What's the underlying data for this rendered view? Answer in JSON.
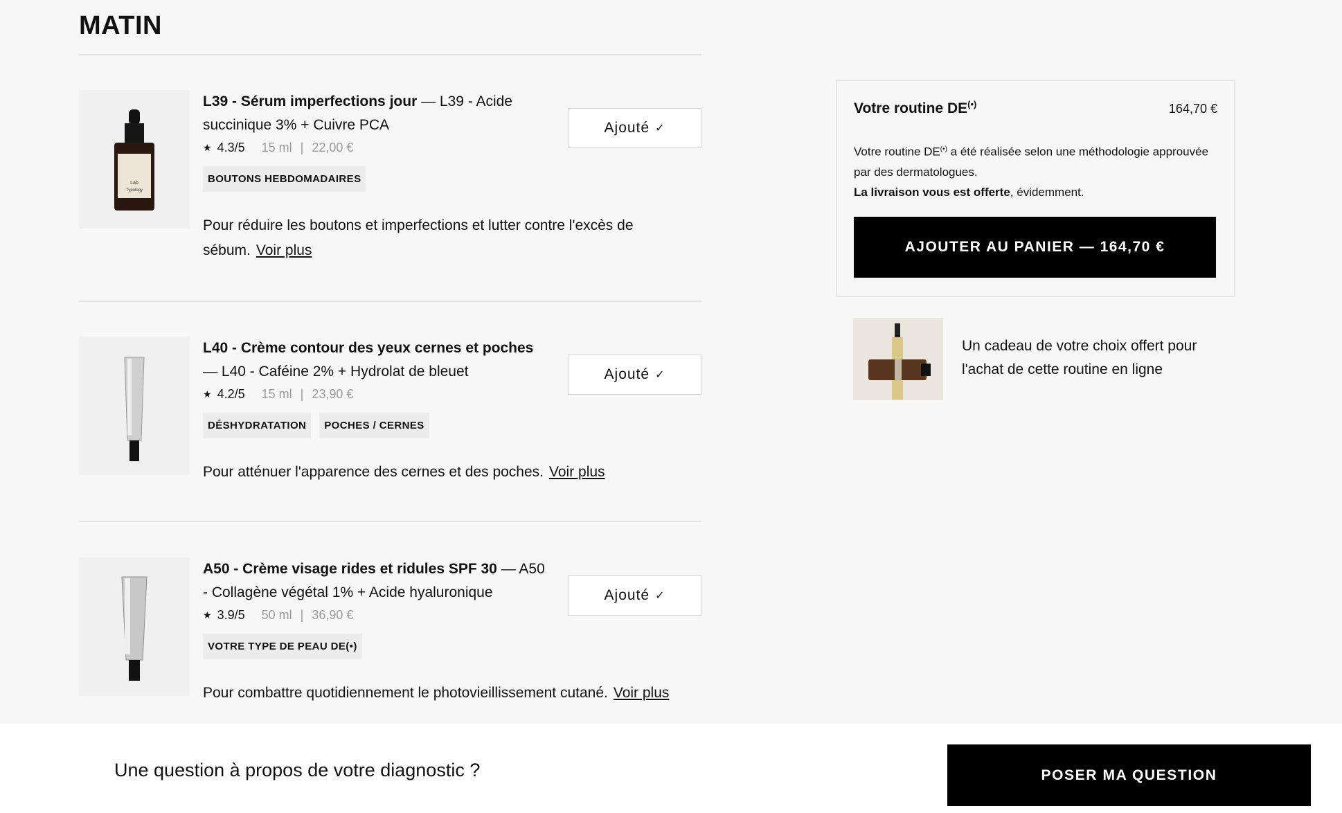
{
  "section": {
    "title": "MATIN"
  },
  "products": [
    {
      "name": "L39 - Sérum imperfections jour",
      "subtitle": " — L39 - Acide succinique 3% + Cuivre PCA",
      "star": "★",
      "rating": "4.3/5",
      "size": "15 ml",
      "separator": "|",
      "price": "22,00 €",
      "tags": [
        "BOUTONS HEBDOMADAIRES"
      ],
      "description": "Pour réduire les boutons et imperfections et lutter contre l'excès de sébum.",
      "more_link": "Voir plus",
      "button_label": "Ajouté",
      "check": "✓",
      "bottle_label_1": "Lab",
      "bottle_label_2": "Typology"
    },
    {
      "name": "L40 - Crème contour des yeux cernes et poches",
      "subtitle": " — L40 - Caféine 2% + Hydrolat de bleuet",
      "star": "★",
      "rating": "4.2/5",
      "size": "15 ml",
      "separator": "|",
      "price": "23,90 €",
      "tags": [
        "DÉSHYDRATATION",
        "POCHES / CERNES"
      ],
      "description": "Pour atténuer l'apparence des cernes et des poches.",
      "more_link": "Voir plus",
      "button_label": "Ajouté",
      "check": "✓"
    },
    {
      "name": "A50 - Crème visage rides et ridules SPF 30",
      "subtitle": " — A50 - Collagène végétal 1% + Acide hyaluronique",
      "star": "★",
      "rating": "3.9/5",
      "size": "50 ml",
      "separator": "|",
      "price": "36,90 €",
      "tags": [
        "VOTRE TYPE DE PEAU DE(•)"
      ],
      "description": "Pour combattre quotidiennement le photovieillissement cutané.",
      "more_link": "Voir plus",
      "button_label": "Ajouté",
      "check": "✓"
    }
  ],
  "summary": {
    "title": "Votre routine DE",
    "title_sup": "(•)",
    "price": "164,70 €",
    "desc_start": "Votre routine DE",
    "desc_sup": "(•)",
    "desc_rest": " a été réalisée selon une méthodologie approuvée par des dermatologues.",
    "delivery_bold": "La livraison vous est offerte",
    "delivery_rest": ", évidemment.",
    "cart_button": "AJOUTER AU PANIER — 164,70 €"
  },
  "gift": {
    "text": "Un cadeau de votre choix offert pour l'achat de cette routine en ligne"
  },
  "bottom_bar": {
    "question": "Une question à propos de votre diagnostic ?",
    "button": "POSER MA QUESTION"
  }
}
